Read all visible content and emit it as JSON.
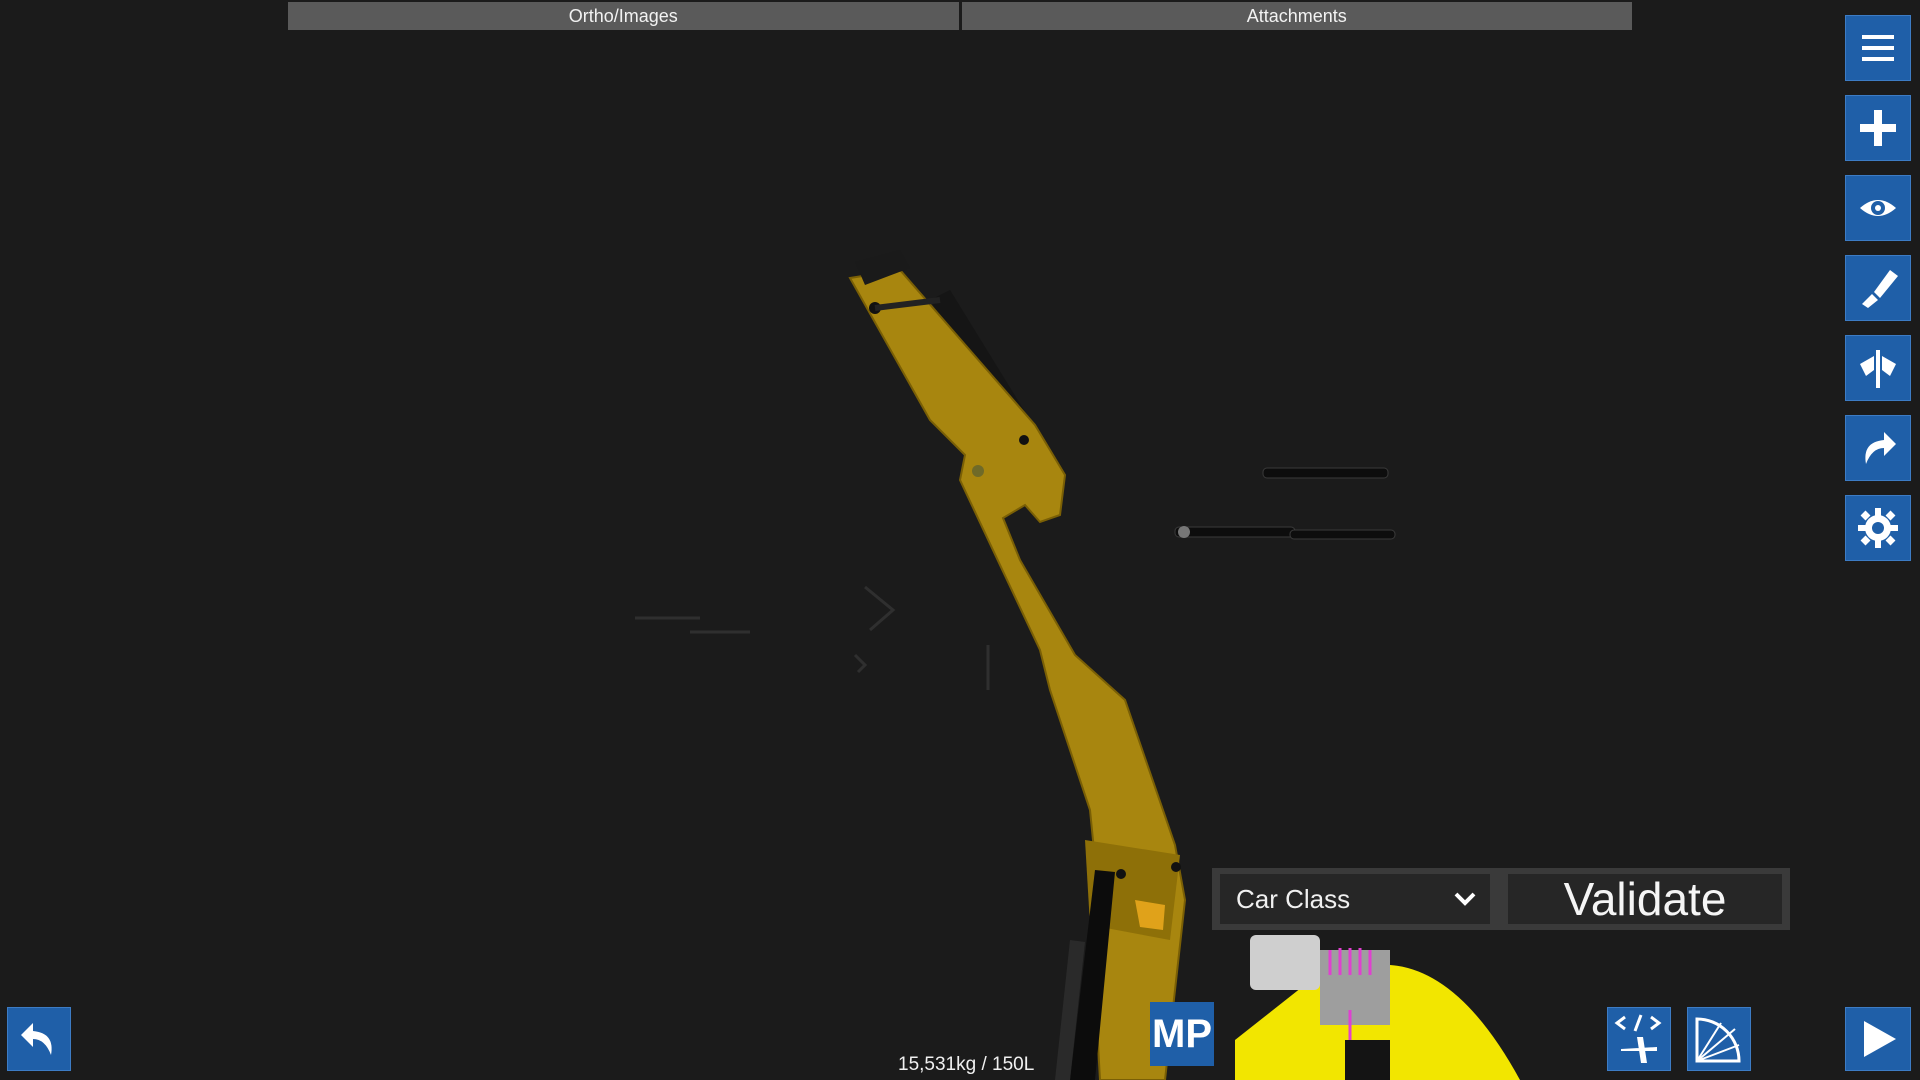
{
  "tabs": [
    {
      "label": "Ortho/Images"
    },
    {
      "label": "Attachments"
    }
  ],
  "toolbar": {
    "items": [
      {
        "icon": "menu-icon"
      },
      {
        "icon": "plus-icon"
      },
      {
        "icon": "eye-icon"
      },
      {
        "icon": "paint-brush-icon"
      },
      {
        "icon": "symmetry-icon"
      },
      {
        "icon": "redo-icon"
      },
      {
        "icon": "gear-icon"
      }
    ]
  },
  "validation": {
    "class_select_value": "Car Class",
    "validate_label": "Validate"
  },
  "status": {
    "mass_fuel": "15,531kg / 150L",
    "mp_badge": "MP"
  },
  "colors": {
    "button_blue": "#1f5fa8",
    "background": "#1b1b1b",
    "arm_yellow": "#a8860f",
    "body_yellow": "#f2e600",
    "accent_magenta": "#e040d0"
  }
}
